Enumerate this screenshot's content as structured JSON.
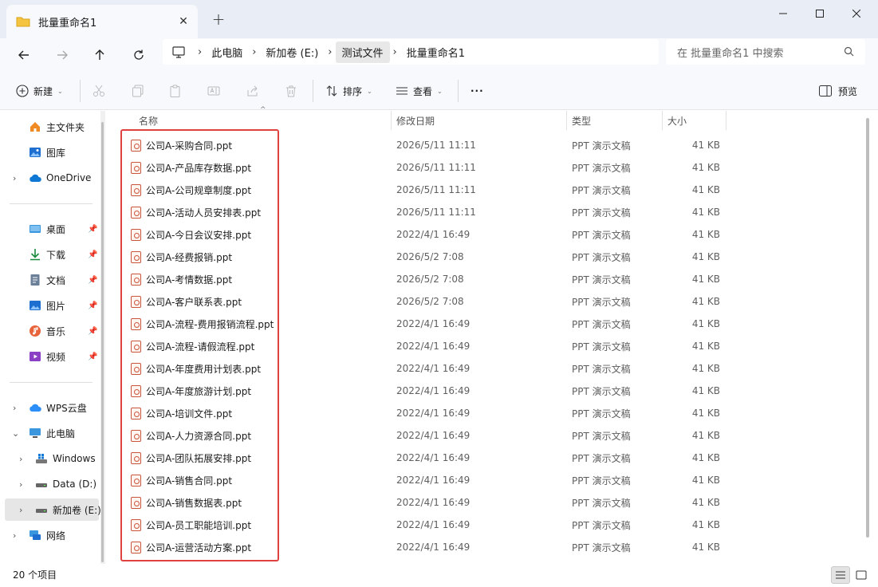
{
  "window": {
    "tab_title": "批量重命名1",
    "new_tab_symbol": "+"
  },
  "address": {
    "breadcrumbs": [
      "此电脑",
      "新加卷 (E:)",
      "测试文件",
      "批量重命名1"
    ],
    "search_placeholder": "在 批量重命名1 中搜索"
  },
  "toolbar": {
    "new_label": "新建",
    "sort_label": "排序",
    "view_label": "查看",
    "more_label": "···",
    "preview_label": "预览"
  },
  "sidebar": {
    "quick": [
      {
        "label": "主文件夹",
        "icon": "home-icon"
      },
      {
        "label": "图库",
        "icon": "gallery-icon"
      },
      {
        "label": "OneDrive",
        "icon": "cloud-icon"
      }
    ],
    "pinned": [
      {
        "label": "桌面",
        "icon": "desktop-icon"
      },
      {
        "label": "下载",
        "icon": "download-icon"
      },
      {
        "label": "文档",
        "icon": "document-icon"
      },
      {
        "label": "图片",
        "icon": "pictures-icon"
      },
      {
        "label": "音乐",
        "icon": "music-icon"
      },
      {
        "label": "视频",
        "icon": "video-icon"
      }
    ],
    "drives": [
      {
        "label": "WPS云盘",
        "icon": "cloud-icon"
      },
      {
        "label": "此电脑",
        "icon": "computer-icon"
      },
      {
        "label": "Windows",
        "icon": "windows-drive-icon"
      },
      {
        "label": "Data (D:)",
        "icon": "drive-icon"
      },
      {
        "label": "新加卷 (E:)",
        "icon": "drive-icon"
      },
      {
        "label": "网络",
        "icon": "network-icon"
      }
    ]
  },
  "columns": {
    "name": "名称",
    "modified": "修改日期",
    "type": "类型",
    "size": "大小"
  },
  "files": [
    {
      "name": "公司A-采购合同.ppt",
      "modified": "2026/5/11 11:11",
      "type": "PPT 演示文稿",
      "size": "41 KB"
    },
    {
      "name": "公司A-产品库存数据.ppt",
      "modified": "2026/5/11 11:11",
      "type": "PPT 演示文稿",
      "size": "41 KB"
    },
    {
      "name": "公司A-公司规章制度.ppt",
      "modified": "2026/5/11 11:11",
      "type": "PPT 演示文稿",
      "size": "41 KB"
    },
    {
      "name": "公司A-活动人员安排表.ppt",
      "modified": "2026/5/11 11:11",
      "type": "PPT 演示文稿",
      "size": "41 KB"
    },
    {
      "name": "公司A-今日会议安排.ppt",
      "modified": "2022/4/1 16:49",
      "type": "PPT 演示文稿",
      "size": "41 KB"
    },
    {
      "name": "公司A-经费报销.ppt",
      "modified": "2026/5/2 7:08",
      "type": "PPT 演示文稿",
      "size": "41 KB"
    },
    {
      "name": "公司A-考情数据.ppt",
      "modified": "2026/5/2 7:08",
      "type": "PPT 演示文稿",
      "size": "41 KB"
    },
    {
      "name": "公司A-客户联系表.ppt",
      "modified": "2026/5/2 7:08",
      "type": "PPT 演示文稿",
      "size": "41 KB"
    },
    {
      "name": "公司A-流程-费用报销流程.ppt",
      "modified": "2022/4/1 16:49",
      "type": "PPT 演示文稿",
      "size": "41 KB"
    },
    {
      "name": "公司A-流程-请假流程.ppt",
      "modified": "2022/4/1 16:49",
      "type": "PPT 演示文稿",
      "size": "41 KB"
    },
    {
      "name": "公司A-年度费用计划表.ppt",
      "modified": "2022/4/1 16:49",
      "type": "PPT 演示文稿",
      "size": "41 KB"
    },
    {
      "name": "公司A-年度旅游计划.ppt",
      "modified": "2022/4/1 16:49",
      "type": "PPT 演示文稿",
      "size": "41 KB"
    },
    {
      "name": "公司A-培训文件.ppt",
      "modified": "2022/4/1 16:49",
      "type": "PPT 演示文稿",
      "size": "41 KB"
    },
    {
      "name": "公司A-人力资源合同.ppt",
      "modified": "2022/4/1 16:49",
      "type": "PPT 演示文稿",
      "size": "41 KB"
    },
    {
      "name": "公司A-团队拓展安排.ppt",
      "modified": "2022/4/1 16:49",
      "type": "PPT 演示文稿",
      "size": "41 KB"
    },
    {
      "name": "公司A-销售合同.ppt",
      "modified": "2022/4/1 16:49",
      "type": "PPT 演示文稿",
      "size": "41 KB"
    },
    {
      "name": "公司A-销售数据表.ppt",
      "modified": "2022/4/1 16:49",
      "type": "PPT 演示文稿",
      "size": "41 KB"
    },
    {
      "name": "公司A-员工职能培训.ppt",
      "modified": "2022/4/1 16:49",
      "type": "PPT 演示文稿",
      "size": "41 KB"
    },
    {
      "name": "公司A-运营活动方案.ppt",
      "modified": "2022/4/1 16:49",
      "type": "PPT 演示文稿",
      "size": "41 KB"
    }
  ],
  "status": {
    "item_count": "20 个项目"
  },
  "colors": {
    "highlight_box": "#e04040",
    "ppt_icon": "#c8553d",
    "accent": "#0067c0"
  }
}
